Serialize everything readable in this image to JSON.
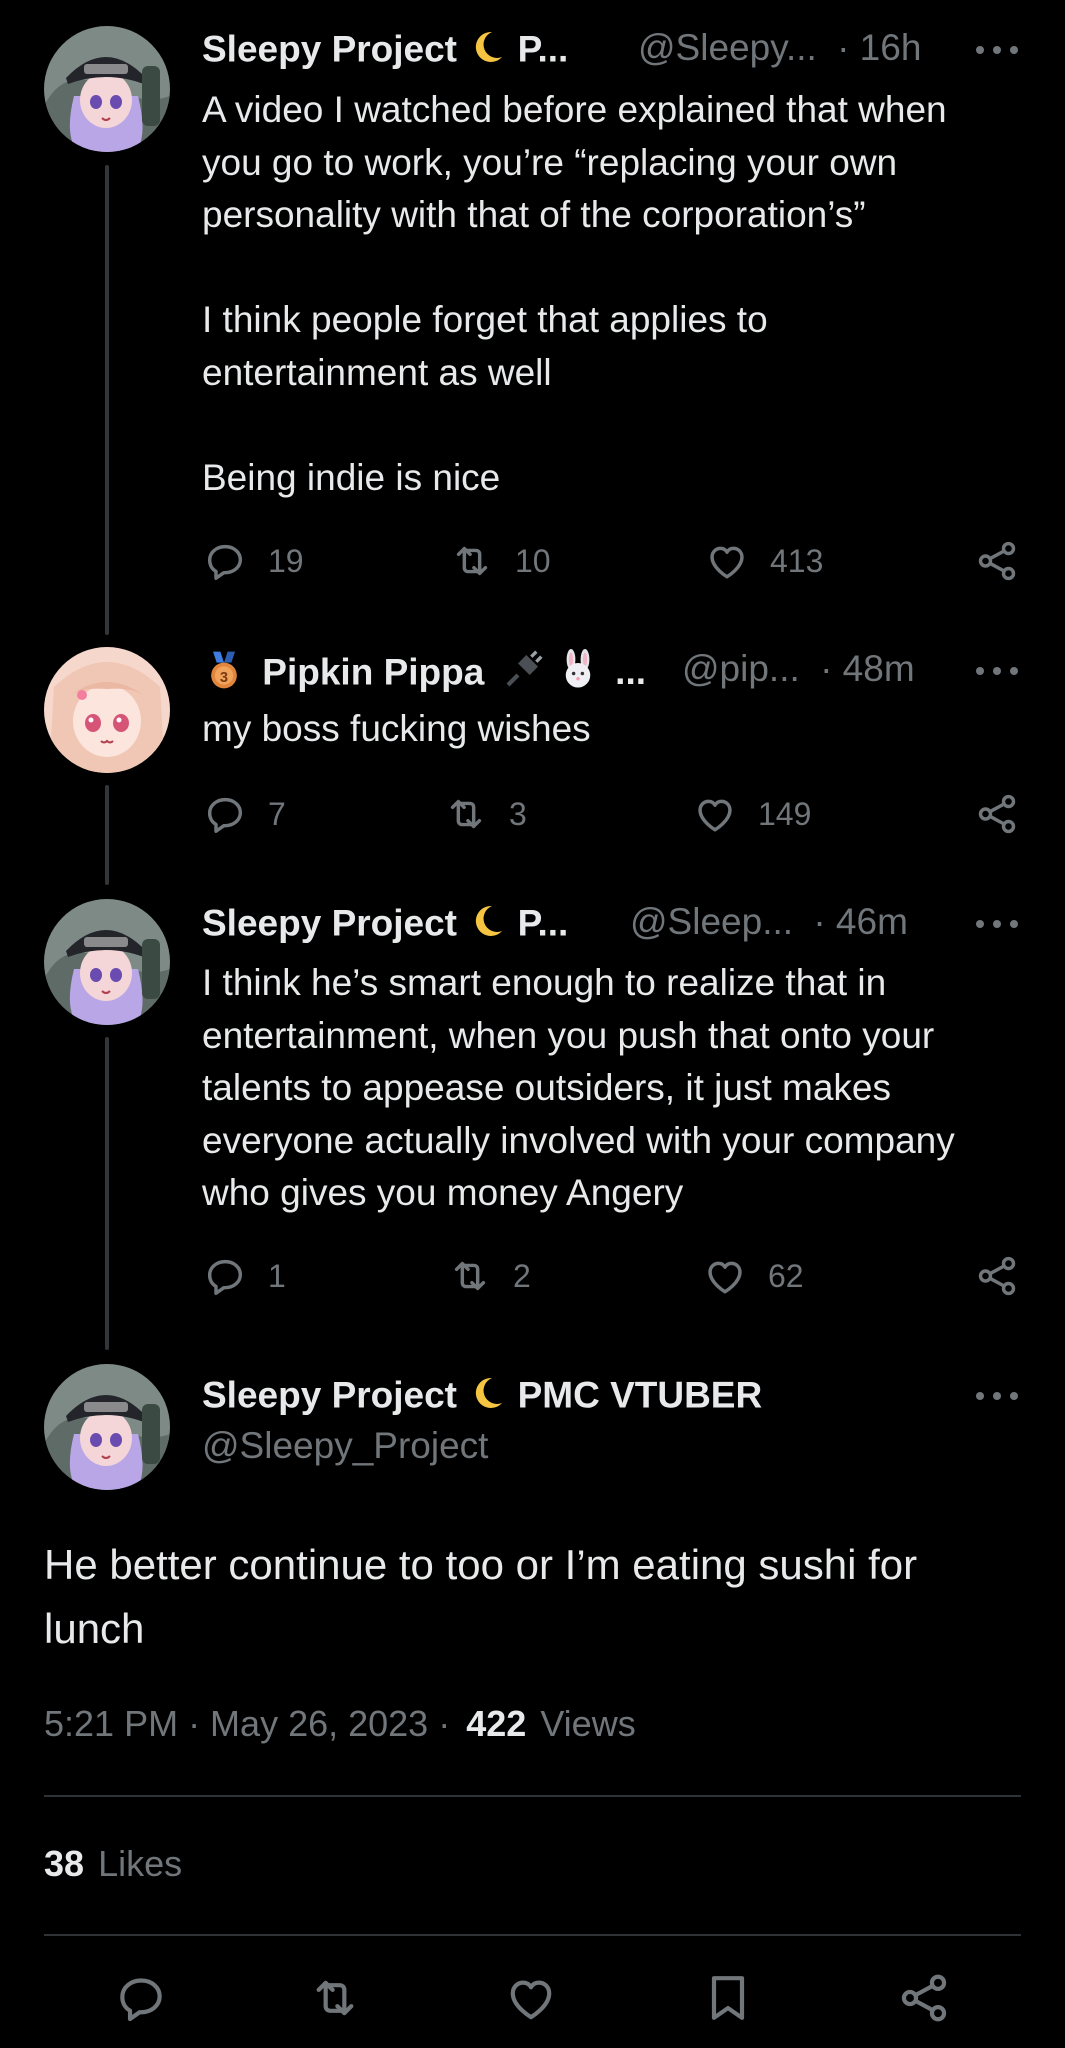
{
  "colors": {
    "bg": "#000000",
    "text": "#e7e9ea",
    "muted": "#71767b",
    "divider": "#2f3336",
    "thread_line": "#333639"
  },
  "tweets": [
    {
      "name": "Sleepy Project",
      "name_suffix": "P...",
      "handle": "@Sleepy...",
      "time": "· 16h",
      "avatar_label": "BEAR",
      "text": "A video I watched before explained that when\nyou go to work, you’re “replacing your own\npersonality with that of the corporation’s”\n\nI think people forget that applies to\nentertainment as well\n\nBeing indie is nice",
      "replies": "19",
      "reposts": "10",
      "likes": "413"
    },
    {
      "name": "Pipkin Pippa",
      "name_suffix": "...",
      "handle": "@pip...",
      "time": "· 48m",
      "text": "my boss fucking wishes",
      "replies": "7",
      "reposts": "3",
      "likes": "149"
    },
    {
      "name": "Sleepy Project",
      "name_suffix": "P...",
      "handle": "@Sleep...",
      "time": "· 46m",
      "avatar_label": "BEAR",
      "text": "I think he’s smart enough to realize that in\nentertainment, when you push that onto your\ntalents to appease outsiders, it just makes\neveryone actually involved with your company\nwho gives you money Angery",
      "replies": "1",
      "reposts": "2",
      "likes": "62"
    }
  ],
  "main_tweet": {
    "name": "Sleepy Project",
    "name_suffix": "PMC VTUBER",
    "handle": "@Sleepy_Project",
    "avatar_label": "BEAR",
    "text": "He better continue to too or I’m eating sushi for\nlunch",
    "timestamp": "5:21 PM · May 26, 2023 ·",
    "views_count": "422",
    "views_label": "Views",
    "likes_count": "38",
    "likes_label": "Likes"
  },
  "icons": {
    "reply": "reply-icon",
    "repost": "repost-icon",
    "like": "heart-icon",
    "share": "share-icon",
    "bookmark": "bookmark-icon",
    "more": "more-icon"
  }
}
